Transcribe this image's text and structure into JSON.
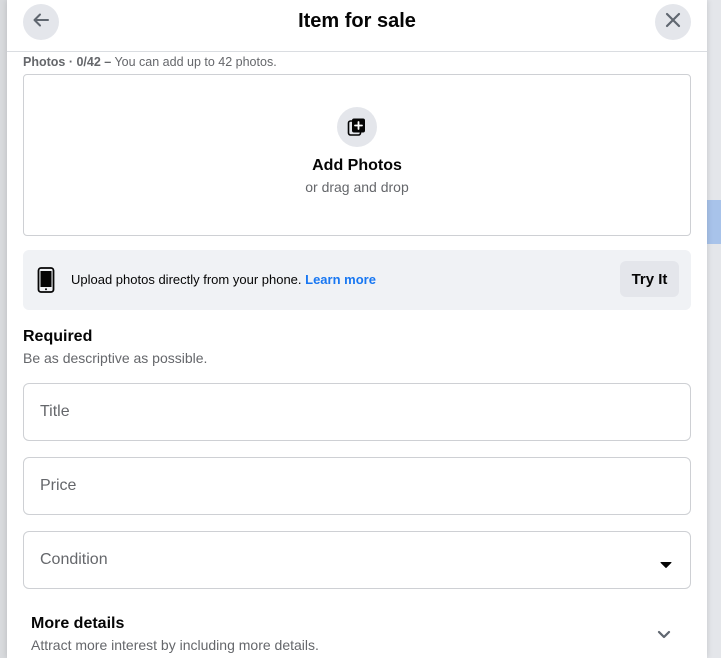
{
  "header": {
    "title": "Item for sale",
    "back_icon": "arrow-left-icon",
    "close_icon": "close-icon"
  },
  "photos": {
    "label": "Photos · 0/42 –",
    "hint": "You can add up to 42 photos.",
    "add_label": "Add Photos",
    "drag_label": "or drag and drop",
    "icon": "add-photo-icon"
  },
  "phone_banner": {
    "text": "Upload photos directly from your phone.",
    "link": "Learn more",
    "button": "Try It",
    "icon": "phone-icon"
  },
  "required": {
    "title": "Required",
    "subtitle": "Be as descriptive as possible."
  },
  "fields": {
    "title_placeholder": "Title",
    "price_placeholder": "Price",
    "condition_placeholder": "Condition"
  },
  "more_details": {
    "title": "More details",
    "subtitle": "Attract more interest by including more details."
  },
  "colors": {
    "accent": "#1877f2",
    "secondary_text": "#65676b",
    "button_bg": "#e4e6eb",
    "banner_bg": "#f0f2f5"
  }
}
